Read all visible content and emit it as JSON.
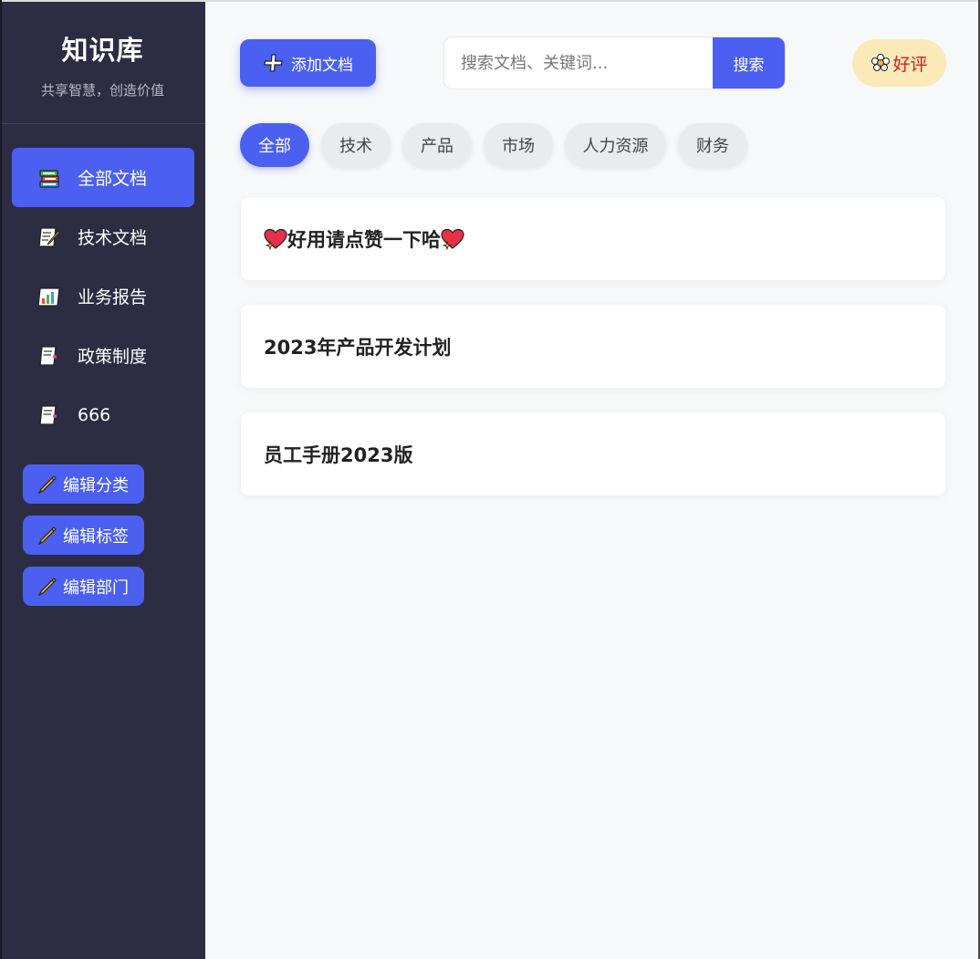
{
  "brand": {
    "title": "知识库",
    "subtitle": "共享智慧，创造价值"
  },
  "sidebar": {
    "items": [
      {
        "label": "全部文档",
        "icon": "books-icon",
        "active": true
      },
      {
        "label": "技术文档",
        "icon": "memo-icon",
        "active": false
      },
      {
        "label": "业务报告",
        "icon": "bar-chart-icon",
        "active": false
      },
      {
        "label": "政策制度",
        "icon": "document-icon",
        "active": false
      },
      {
        "label": "666",
        "icon": "document-icon",
        "active": false
      }
    ],
    "edit_buttons": [
      {
        "label": "编辑分类",
        "icon": "pencil-icon"
      },
      {
        "label": "编辑标签",
        "icon": "pencil-icon"
      },
      {
        "label": "编辑部门",
        "icon": "pencil-icon"
      }
    ]
  },
  "toolbar": {
    "add_label": "添加文档",
    "search_placeholder": "搜索文档、关键词...",
    "search_label": "搜索",
    "good_label": "好评"
  },
  "tags": [
    "全部",
    "技术",
    "产品",
    "市场",
    "人力资源",
    "财务"
  ],
  "documents": [
    {
      "title": "好用请点赞一下哈",
      "icon": "sparkling-heart-icon"
    },
    {
      "title": "2023年产品开发计划"
    },
    {
      "title": "员工手册2023版"
    }
  ],
  "colors": {
    "accent": "#4b60f0",
    "sidebar": "#2c2d42",
    "good_bg": "#fbe9b7",
    "good_text": "#d02020"
  }
}
